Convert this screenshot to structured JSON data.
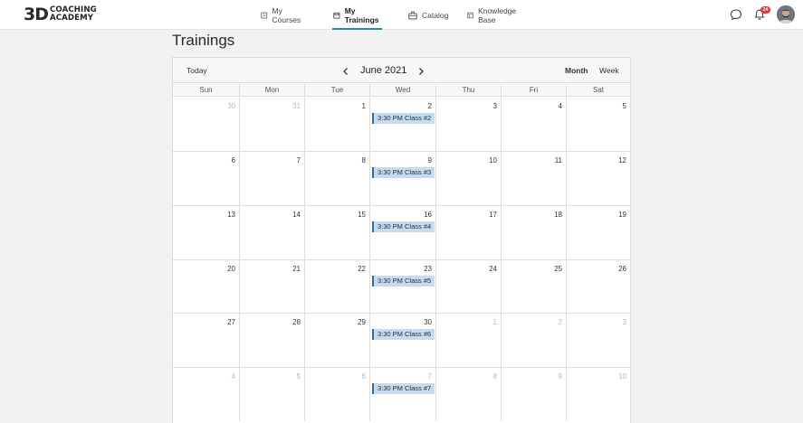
{
  "header": {
    "logo_mark": "3D",
    "logo_line1": "COACHING",
    "logo_line2": "ACADEMY",
    "nav": [
      {
        "label": "My Courses",
        "icon": "book-icon",
        "active": false
      },
      {
        "label": "My Trainings",
        "icon": "calendar-icon",
        "active": true
      },
      {
        "label": "Catalog",
        "icon": "briefcase-icon",
        "active": false
      },
      {
        "label": "Knowledge Base",
        "icon": "document-icon",
        "active": false
      }
    ],
    "notification_count": "24",
    "accent_color": "#1f8db0"
  },
  "page": {
    "title": "Trainings"
  },
  "calendar": {
    "today_label": "Today",
    "month_label": "June 2021",
    "view_month_label": "Month",
    "view_week_label": "Week",
    "weekdays": [
      "Sun",
      "Mon",
      "Tue",
      "Wed",
      "Thu",
      "Fri",
      "Sat"
    ],
    "weeks": [
      [
        {
          "d": "30",
          "other": true
        },
        {
          "d": "31",
          "other": true
        },
        {
          "d": "1"
        },
        {
          "d": "2",
          "event": "3:30 PM Class #2"
        },
        {
          "d": "3"
        },
        {
          "d": "4"
        },
        {
          "d": "5"
        }
      ],
      [
        {
          "d": "6"
        },
        {
          "d": "7"
        },
        {
          "d": "8"
        },
        {
          "d": "9",
          "event": "3:30 PM Class #3"
        },
        {
          "d": "10"
        },
        {
          "d": "11"
        },
        {
          "d": "12"
        }
      ],
      [
        {
          "d": "13"
        },
        {
          "d": "14"
        },
        {
          "d": "15"
        },
        {
          "d": "16",
          "event": "3:30 PM Class #4"
        },
        {
          "d": "17"
        },
        {
          "d": "18"
        },
        {
          "d": "19"
        }
      ],
      [
        {
          "d": "20"
        },
        {
          "d": "21"
        },
        {
          "d": "22"
        },
        {
          "d": "23",
          "event": "3:30 PM Class #5"
        },
        {
          "d": "24"
        },
        {
          "d": "25"
        },
        {
          "d": "26"
        }
      ],
      [
        {
          "d": "27"
        },
        {
          "d": "28"
        },
        {
          "d": "29"
        },
        {
          "d": "30",
          "event": "3:30 PM Class #6"
        },
        {
          "d": "1",
          "other": true
        },
        {
          "d": "2",
          "other": true
        },
        {
          "d": "3",
          "other": true
        }
      ],
      [
        {
          "d": "4",
          "other": true
        },
        {
          "d": "5",
          "other": true
        },
        {
          "d": "6",
          "other": true
        },
        {
          "d": "7",
          "other": true,
          "event": "3:30 PM Class #7"
        },
        {
          "d": "8",
          "other": true
        },
        {
          "d": "9",
          "other": true
        },
        {
          "d": "10",
          "other": true
        }
      ]
    ],
    "event_color": "#c6dcee",
    "event_border_color": "#2d6fa4"
  }
}
